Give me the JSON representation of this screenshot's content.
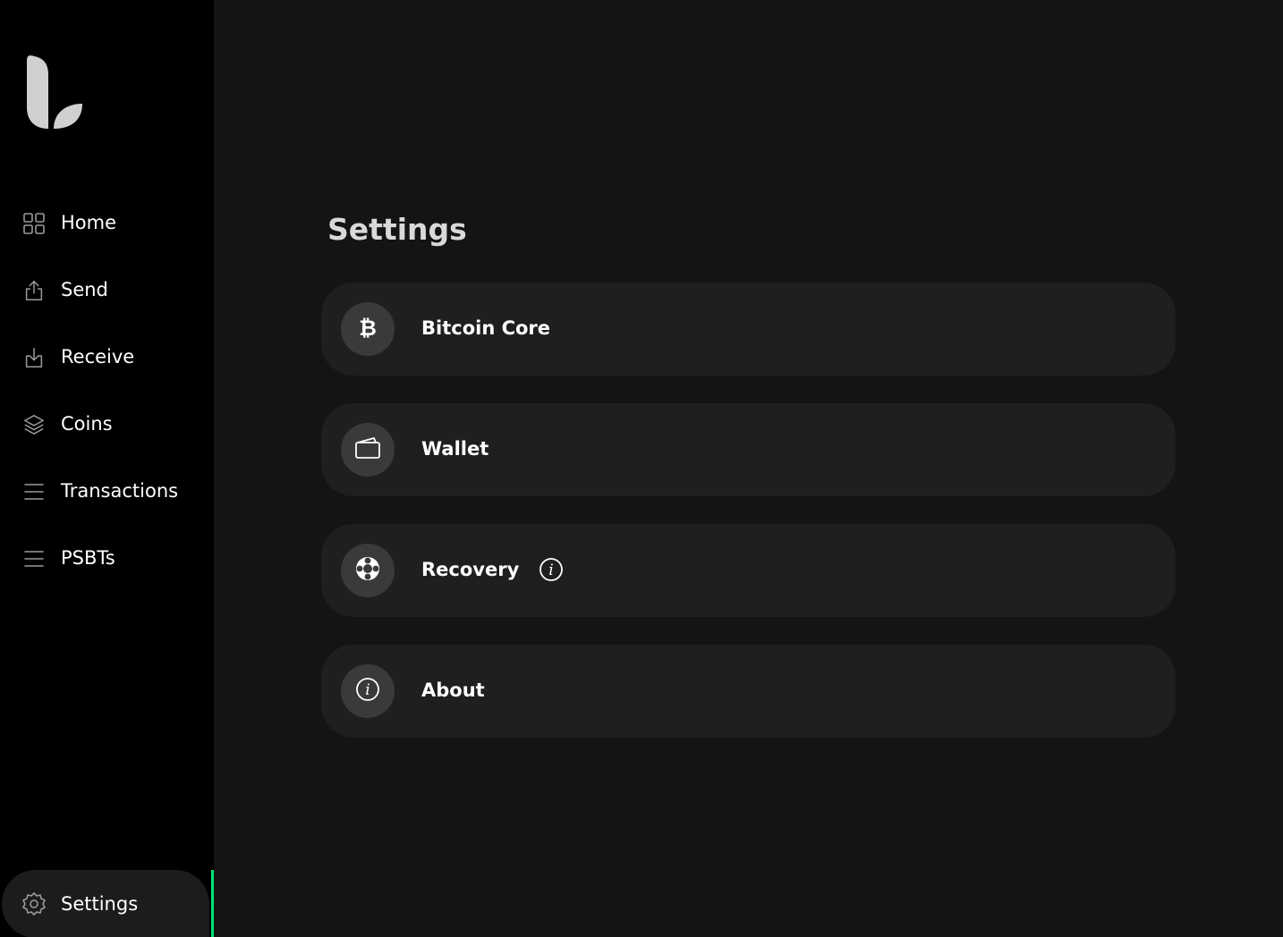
{
  "sidebar": {
    "logo_icon": "leaf-logo",
    "items": [
      {
        "label": "Home",
        "icon": "grid-icon"
      },
      {
        "label": "Send",
        "icon": "upload-icon"
      },
      {
        "label": "Receive",
        "icon": "download-icon"
      },
      {
        "label": "Coins",
        "icon": "layers-icon"
      },
      {
        "label": "Transactions",
        "icon": "list-icon"
      },
      {
        "label": "PSBTs",
        "icon": "list-icon"
      }
    ],
    "settings": {
      "label": "Settings",
      "icon": "gear-icon"
    },
    "active_item": "Settings",
    "active_color": "#00e676"
  },
  "main": {
    "title": "Settings",
    "cards": [
      {
        "label": "Bitcoin Core",
        "icon": "bitcoin-icon"
      },
      {
        "label": "Wallet",
        "icon": "wallet-icon"
      },
      {
        "label": "Recovery",
        "icon": "lifebuoy-icon",
        "has_info": true
      },
      {
        "label": "About",
        "icon": "info-icon"
      }
    ]
  },
  "colors": {
    "sidebar_bg": "#000000",
    "main_bg": "#141414",
    "card_bg": "#1f1f1f",
    "icon_circle_bg": "#3a3a3a",
    "accent": "#00e676"
  }
}
